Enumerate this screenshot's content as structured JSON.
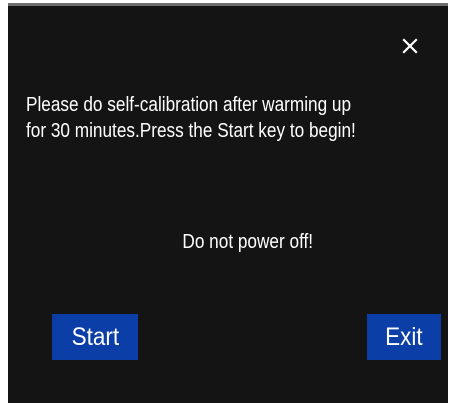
{
  "dialog": {
    "message_lines": [
      "Please do self-calibration after warming up",
      "for 30 minutes.Press the Start key to begin!"
    ],
    "warning": "Do not power off!",
    "start_label": "Start",
    "exit_label": "Exit",
    "close_icon": "close-icon"
  },
  "colors": {
    "background": "#141414",
    "button": "#0b3ea6",
    "text": "#ffffff",
    "top_border": "#6e6e6e"
  }
}
